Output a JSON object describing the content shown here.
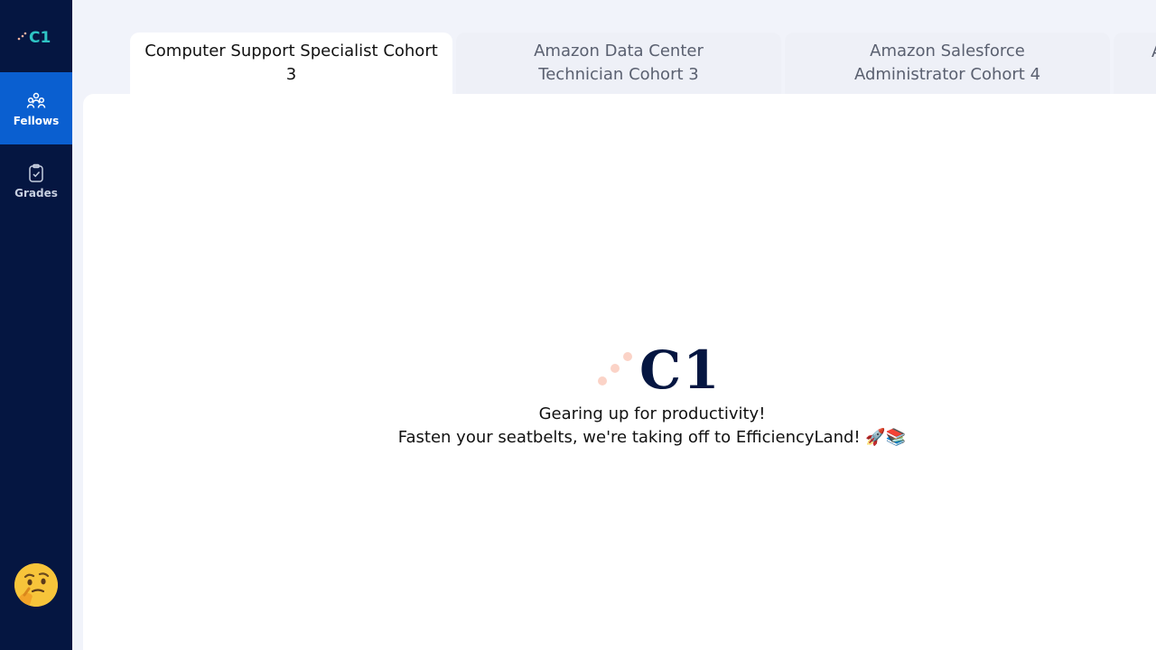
{
  "sidebar": {
    "logo_text": "C1",
    "items": [
      {
        "label": "Fellows",
        "icon": "people-group-icon",
        "active": true
      },
      {
        "label": "Grades",
        "icon": "clipboard-check-icon",
        "active": false
      }
    ],
    "avatar_icon": "thinking-face-icon"
  },
  "tabs": [
    {
      "label": "Computer Support Specialist Cohort 3",
      "active": true
    },
    {
      "label": "Amazon Data Center Technician Cohort 3",
      "active": false
    },
    {
      "label": "Amazon Salesforce Administrator Cohort 4",
      "active": false
    },
    {
      "label": "A",
      "active": false
    }
  ],
  "loader": {
    "logo_text": "C1",
    "line1": "Gearing up for productivity!",
    "line2": "Fasten your seatbelts, we're taking off to EfficiencyLand! 🚀📚"
  },
  "colors": {
    "sidebar_bg": "#051641",
    "active_nav": "#0a5fd0",
    "brand_teal": "#2ec4c4",
    "brand_dots": "#f7b3a1",
    "page_bg": "#f1f3fa"
  }
}
